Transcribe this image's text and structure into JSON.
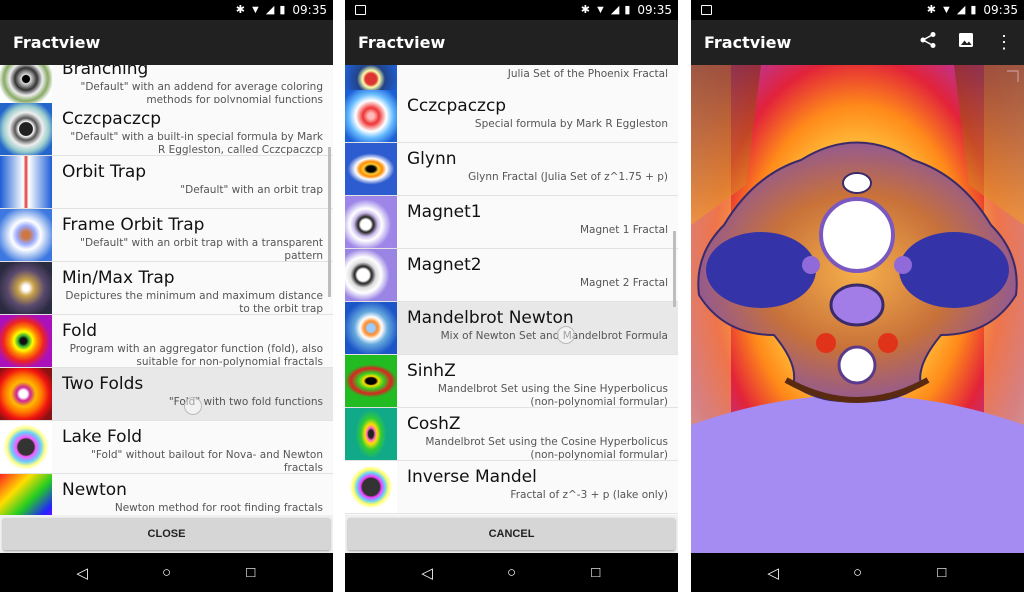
{
  "status": {
    "time": "09:35"
  },
  "panel1": {
    "title": "Fractview",
    "button": "CLOSE",
    "items": [
      {
        "name": "Branching",
        "desc": "\"Default\" with an addend for average coloring methods for polynomial functions"
      },
      {
        "name": "Cczcpaczcp",
        "desc": "\"Default\" with a built-in special formula by Mark R Eggleston, called Cczcpaczcp"
      },
      {
        "name": "Orbit Trap",
        "desc": "\"Default\" with an orbit trap"
      },
      {
        "name": "Frame Orbit Trap",
        "desc": "\"Default\" with an orbit trap with a transparent pattern"
      },
      {
        "name": "Min/Max Trap",
        "desc": "Depictures the minimum and maximum distance to the orbit trap"
      },
      {
        "name": "Fold",
        "desc": "Program with an aggregator function (fold), also suitable for non-polynomial fractals"
      },
      {
        "name": "Two Folds",
        "desc": "\"Fold\" with two fold functions"
      },
      {
        "name": "Lake Fold",
        "desc": "\"Fold\" without bailout for Nova- and Newton fractals"
      },
      {
        "name": "Newton",
        "desc": "Newton method for root finding fractals"
      }
    ]
  },
  "panel2": {
    "title": "Fractview",
    "button": "CANCEL",
    "items": [
      {
        "name": "",
        "desc": "Julia Set of the Phoenix Fractal"
      },
      {
        "name": "Cczcpaczcp",
        "desc": "Special formula by Mark R Eggleston"
      },
      {
        "name": "Glynn",
        "desc": "Glynn Fractal (Julia Set of z^1.75 + p)"
      },
      {
        "name": "Magnet1",
        "desc": "Magnet 1 Fractal"
      },
      {
        "name": "Magnet2",
        "desc": "Magnet 2 Fractal"
      },
      {
        "name": "Mandelbrot Newton",
        "desc": "Mix of Newton Set and Mandelbrot Formula"
      },
      {
        "name": "SinhZ",
        "desc": "Mandelbrot Set using the Sine Hyperbolicus (non-polynomial formular)"
      },
      {
        "name": "CoshZ",
        "desc": "Mandelbrot Set using the Cosine Hyperbolicus (non-polynomial formular)"
      },
      {
        "name": "Inverse Mandel",
        "desc": "Fractal of z^-3 + p (lake only)"
      }
    ]
  },
  "panel3": {
    "title": "Fractview"
  },
  "icons": {
    "bluetooth": "bluetooth-icon",
    "wifi": "wifi-icon",
    "signal": "signal-icon",
    "battery": "battery-icon",
    "share": "share-icon",
    "image": "image-icon",
    "more": "more-vert-icon",
    "back": "back-icon",
    "home": "home-icon",
    "recents": "recents-icon"
  }
}
